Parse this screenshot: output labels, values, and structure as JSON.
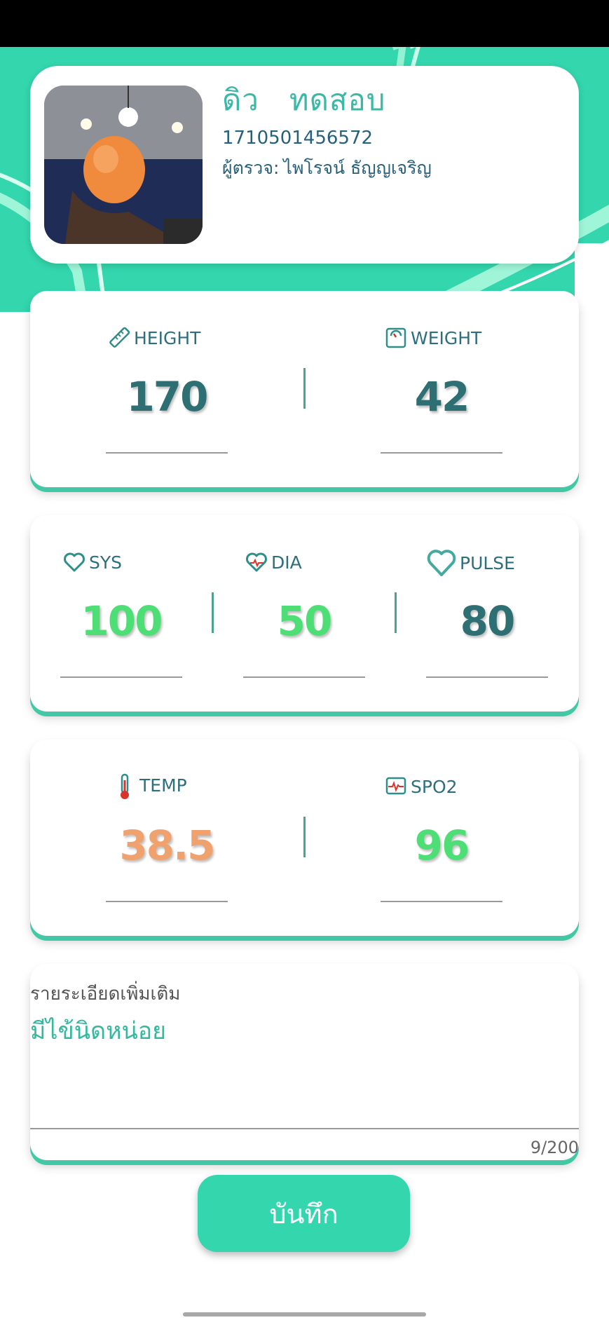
{
  "theme": {
    "accent": "#33d6ad",
    "value_dark": "#2e6f73",
    "value_green": "#4ede76",
    "value_orange": "#f0a26e"
  },
  "profile": {
    "name": "ดิว   ทดสอบ",
    "id": "1710501456572",
    "examiner_label": "ผู้ตรวจ:",
    "examiner_name": "ไพโรจน์ ธัญญเจริญ"
  },
  "body": {
    "height": {
      "label": "HEIGHT",
      "value": "170",
      "icon": "ruler-icon"
    },
    "weight": {
      "label": "WEIGHT",
      "value": "42",
      "icon": "scale-icon"
    }
  },
  "blood_pressure": {
    "sys": {
      "label": "SYS",
      "value": "100",
      "icon": "heart-icon"
    },
    "dia": {
      "label": "DIA",
      "value": "50",
      "icon": "heart-pulse-icon"
    },
    "pulse": {
      "label": "PULSE",
      "value": "80",
      "icon": "heart-icon"
    }
  },
  "vitals": {
    "temp": {
      "label": "TEMP",
      "value": "38.5",
      "icon": "thermometer-icon"
    },
    "spo2": {
      "label": "SPO2",
      "value": "96",
      "icon": "monitor-pulse-icon"
    }
  },
  "notes": {
    "label": "รายระเอียดเพิ่มเติม",
    "value": "มีไข้นิดหน่อย",
    "counter": "9/200"
  },
  "save_button": {
    "label": "บันทึก"
  }
}
